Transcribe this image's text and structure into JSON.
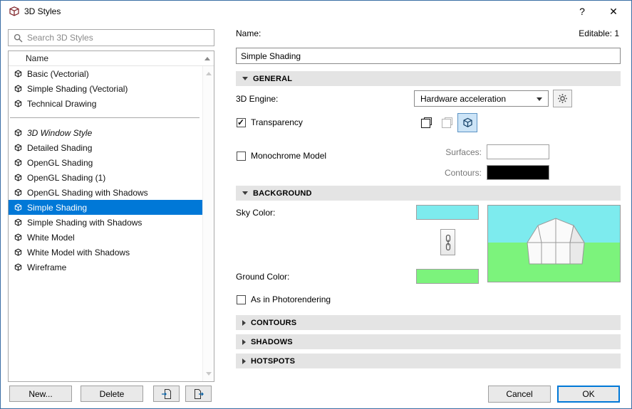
{
  "window": {
    "title": "3D Styles",
    "help_label": "?",
    "close_label": "✕"
  },
  "search": {
    "placeholder": "Search 3D Styles"
  },
  "list": {
    "header": "Name",
    "items": [
      {
        "label": "Basic (Vectorial)"
      },
      {
        "label": "Simple Shading (Vectorial)"
      },
      {
        "label": "Technical Drawing"
      },
      {
        "separator": true
      },
      {
        "label": "3D Window Style",
        "italic": true
      },
      {
        "label": "Detailed Shading"
      },
      {
        "label": "OpenGL Shading"
      },
      {
        "label": "OpenGL Shading (1)"
      },
      {
        "label": "OpenGL Shading with Shadows"
      },
      {
        "label": "Simple Shading",
        "selected": true
      },
      {
        "label": "Simple Shading with Shadows"
      },
      {
        "label": "White Model"
      },
      {
        "label": "White Model with Shadows"
      },
      {
        "label": "Wireframe"
      }
    ]
  },
  "left_footer": {
    "new_label": "New...",
    "delete_label": "Delete"
  },
  "detail": {
    "name_label": "Name:",
    "editable_label": "Editable: 1",
    "name_value": "Simple Shading",
    "general": {
      "title": "GENERAL",
      "engine_label": "3D Engine:",
      "engine_value": "Hardware acceleration",
      "transparency_label": "Transparency",
      "transparency_checked": true,
      "monochrome_label": "Monochrome Model",
      "monochrome_checked": false,
      "surfaces_label": "Surfaces:",
      "surfaces_color": "#ffffff",
      "contours_label": "Contours:",
      "contours_color": "#000000"
    },
    "background": {
      "title": "BACKGROUND",
      "sky_label": "Sky Color:",
      "sky_color": "#7debee",
      "ground_label": "Ground Color:",
      "ground_color": "#7cf37c"
    },
    "photorendering_label": "As in Photorendering",
    "photorendering_checked": false,
    "collapsed_sections": [
      {
        "title": "CONTOURS"
      },
      {
        "title": "SHADOWS"
      },
      {
        "title": "HOTSPOTS"
      }
    ]
  },
  "footer": {
    "cancel_label": "Cancel",
    "ok_label": "OK"
  },
  "colors": {
    "selection": "#0078d7",
    "selected_tool_bg": "#cce4f7",
    "selected_tool_border": "#5c93c4"
  }
}
